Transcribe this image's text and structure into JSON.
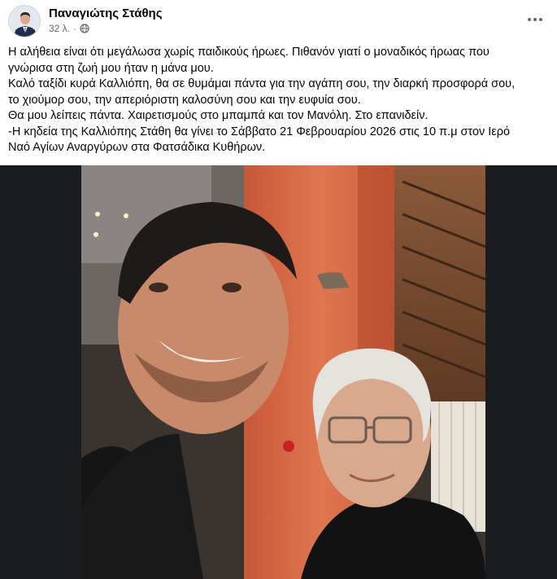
{
  "post": {
    "author": "Παναγιώτης Στάθης",
    "time": "32 λ.",
    "separator": "·",
    "privacy_icon": "globe-icon",
    "more_icon": "more-options-icon",
    "text_lines": [
      "Η αλήθεια είναι ότι μεγάλωσα χωρίς παιδικούς ήρωες. Πιθανόν γιατί ο μοναδικός ήρωας που",
      "γνώρισα στη ζωή μου ήταν η μάνα μου.",
      "Καλό ταξίδι κυρά Καλλιόπη, θα σε θυμάμαι πάντα για την αγάπη σου, την διαρκή προσφορά σου,",
      "το χιούμορ σου, την απεριόριστη καλοσύνη σου και την ευφυία σου.",
      "Θα μου λείπεις πάντα. Χαιρετισμούς στο μπαμπά και τον Μανόλη. Στο επανιδείν.",
      "-Η κηδεία της Καλλιόπης Στάθη θα γίνει το Σάββατο 21 Φεβρουαρίου 2026 στις 10 π.μ  στον Ιερό",
      "Ναό Αγίων Αναργύρων στα Φατσάδικα Κυθήρων."
    ]
  },
  "colors": {
    "text": "#050505",
    "secondary": "#65676b",
    "photo_backdrop": "#1b1c1d"
  }
}
